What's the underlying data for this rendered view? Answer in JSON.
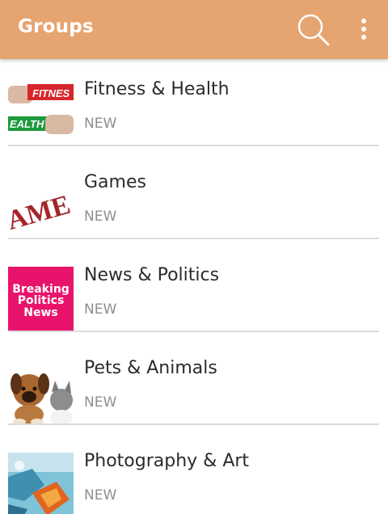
{
  "app_bar": {
    "title": "Groups",
    "color": "#e6a470",
    "actions": [
      {
        "icon": "search-icon"
      },
      {
        "icon": "more-vert-icon"
      }
    ]
  },
  "groups": [
    {
      "title": "Fitness & Health",
      "badge": "NEW",
      "thumbnail_text": [
        "FITNES",
        "EALTH"
      ]
    },
    {
      "title": "Games",
      "badge": "NEW",
      "thumbnail_text": [
        "AME"
      ]
    },
    {
      "title": "News & Politics",
      "badge": "NEW",
      "thumbnail_text": [
        "Breaking",
        "Politics",
        "News"
      ]
    },
    {
      "title": "Pets & Animals",
      "badge": "NEW",
      "thumbnail_text": []
    },
    {
      "title": "Photography & Art",
      "badge": "NEW",
      "thumbnail_text": []
    }
  ]
}
